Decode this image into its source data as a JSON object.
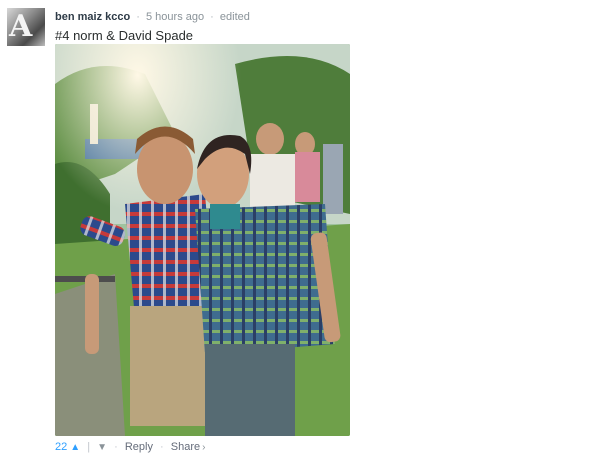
{
  "comment": {
    "author": "ben maiz kcco",
    "time": "5 hours ago",
    "edited": "edited",
    "text": "#4 norm & David Spade",
    "separator": "·"
  },
  "footer": {
    "votes": "22",
    "upvote_icon": "chevron-up-icon",
    "downvote_icon": "chevron-down-icon",
    "bar": "|",
    "reply_label": "Reply",
    "share_label": "Share",
    "share_icon": "chevron-right-icon"
  },
  "colors": {
    "author": "#2e3b47",
    "meta": "#8a9399",
    "accent": "#2e9fff",
    "link": "#656c7a"
  }
}
